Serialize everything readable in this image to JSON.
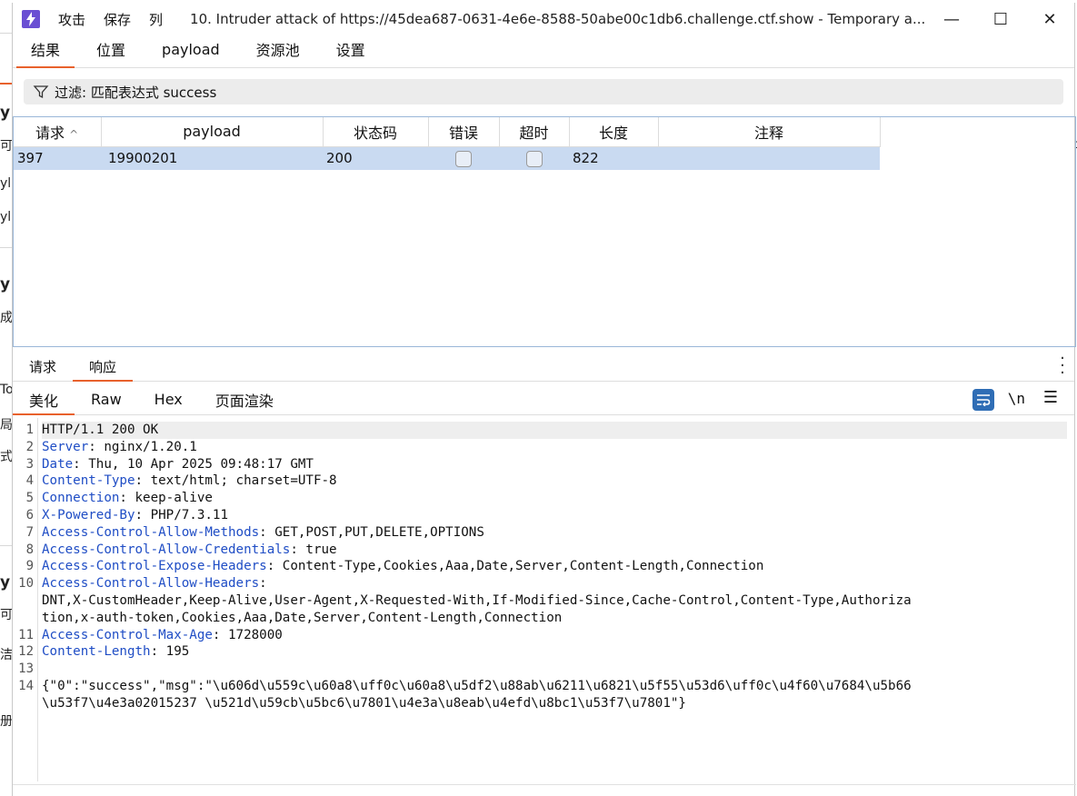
{
  "window": {
    "title": "10. Intruder attack of https://45dea687-0631-4e6e-8588-50abe00c1db6.challenge.ctf.show - Temporary a...",
    "menus": [
      "攻击",
      "保存",
      "列"
    ],
    "minimize": "—",
    "maximize": "☐",
    "close": "✕"
  },
  "main_tabs": [
    "结果",
    "位置",
    "payload",
    "资源池",
    "设置"
  ],
  "filter": {
    "text": "过滤: 匹配表达式 success"
  },
  "results_table": {
    "headers": [
      "请求",
      "payload",
      "状态码",
      "错误",
      "超时",
      "长度",
      "注释"
    ],
    "sort_indicator": "^",
    "rows": [
      {
        "request": "397",
        "payload": "19900201",
        "status": "200",
        "error": false,
        "timeout": false,
        "length": "822",
        "comment": ""
      }
    ]
  },
  "response_tabs": [
    "请求",
    "响应"
  ],
  "view_tabs": [
    "美化",
    "Raw",
    "Hex",
    "页面渲染"
  ],
  "view_icons": {
    "newline": "\\n"
  },
  "response_lines": [
    {
      "n": "1",
      "key": "",
      "value": "HTTP/1.1 200 OK"
    },
    {
      "n": "2",
      "key": "Server",
      "value": " nginx/1.20.1"
    },
    {
      "n": "3",
      "key": "Date",
      "value": " Thu, 10 Apr 2025 09:48:17 GMT"
    },
    {
      "n": "4",
      "key": "Content-Type",
      "value": " text/html; charset=UTF-8"
    },
    {
      "n": "5",
      "key": "Connection",
      "value": " keep-alive"
    },
    {
      "n": "6",
      "key": "X-Powered-By",
      "value": " PHP/7.3.11"
    },
    {
      "n": "7",
      "key": "Access-Control-Allow-Methods",
      "value": " GET,POST,PUT,DELETE,OPTIONS"
    },
    {
      "n": "8",
      "key": "Access-Control-Allow-Credentials",
      "value": " true"
    },
    {
      "n": "9",
      "key": "Access-Control-Expose-Headers",
      "value": " Content-Type,Cookies,Aaa,Date,Server,Content-Length,Connection"
    },
    {
      "n": "10",
      "key": "Access-Control-Allow-Headers",
      "value": ""
    },
    {
      "n": "",
      "key": "",
      "value": "DNT,X-CustomHeader,Keep-Alive,User-Agent,X-Requested-With,If-Modified-Since,Cache-Control,Content-Type,Authoriza"
    },
    {
      "n": "",
      "key": "",
      "value": "tion,x-auth-token,Cookies,Aaa,Date,Server,Content-Length,Connection"
    },
    {
      "n": "11",
      "key": "Access-Control-Max-Age",
      "value": " 1728000"
    },
    {
      "n": "12",
      "key": "Content-Length",
      "value": " 195"
    },
    {
      "n": "13",
      "key": "",
      "value": ""
    },
    {
      "n": "14",
      "key": "",
      "value": "{\"0\":\"success\",\"msg\":\"\\u606d\\u559c\\u60a8\\uff0c\\u60a8\\u5df2\\u88ab\\u6211\\u6821\\u5f55\\u53d6\\uff0c\\u4f60\\u7684\\u5b66"
    },
    {
      "n": "",
      "key": "",
      "value": "\\u53f7\\u4e3a02015237 \\u521d\\u59cb\\u5bc6\\u7801\\u4e3a\\u8eab\\u4efd\\u8bc1\\u53f7\\u7801\"}"
    }
  ],
  "background": {
    "left_glyphs": [
      "y",
      "可",
      "yl",
      "yl",
      "y",
      "成",
      "To",
      "局",
      "式",
      "y",
      "可",
      "洁",
      "册"
    ],
    "right_glyph": "c"
  },
  "colors": {
    "accent": "#e8612c",
    "selected_row": "#c9daf1",
    "header_key": "#1f4dc5",
    "app_icon": "#6a4fd3"
  }
}
